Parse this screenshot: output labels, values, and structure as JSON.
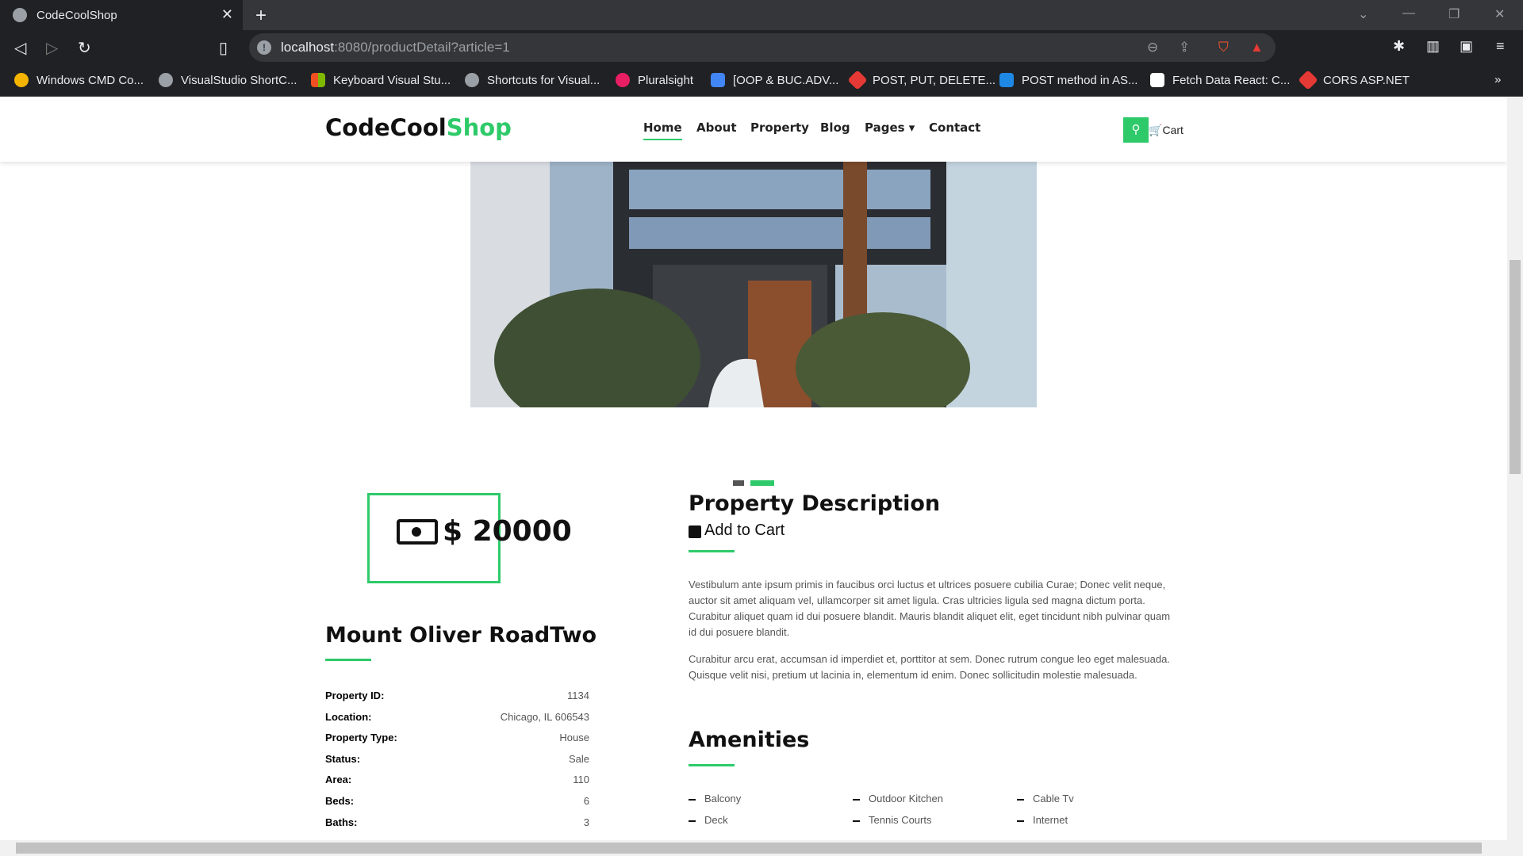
{
  "browser": {
    "tab_title": "CodeCoolShop",
    "url_host": "localhost",
    "url_rest": ":8080/productDetail?article=1",
    "bookmarks": [
      {
        "label": "Windows CMD Co...",
        "color": "#f4b400"
      },
      {
        "label": "VisualStudio ShortC...",
        "color": "#9aa0a6"
      },
      {
        "label": "Keyboard Visual Stu...",
        "color": "#f25022"
      },
      {
        "label": "Shortcuts for Visual...",
        "color": "#9aa0a6"
      },
      {
        "label": "Pluralsight",
        "color": "#e91e63"
      },
      {
        "label": "[OOP & BUC.ADV...",
        "color": "#4285f4"
      },
      {
        "label": "POST, PUT, DELETE...",
        "color": "#e53935"
      },
      {
        "label": "POST method in AS...",
        "color": "#1e88e5"
      },
      {
        "label": "Fetch Data React: C...",
        "color": "#ffffff"
      },
      {
        "label": "CORS ASP.NET",
        "color": "#e53935"
      }
    ],
    "more": "»"
  },
  "header": {
    "logo_main": "CodeCool",
    "logo_accent": "Shop",
    "nav": [
      "Home",
      "About",
      "Property",
      "Blog",
      "Pages",
      "Contact"
    ],
    "cart_label": "Cart"
  },
  "product": {
    "price": "$ 20000",
    "name": "Mount Oliver RoadTwo",
    "add_to_cart": "Add to Cart",
    "description_title": "Property Description",
    "description_p1": "Vestibulum ante ipsum primis in faucibus orci luctus et ultrices posuere cubilia Curae; Donec velit neque, auctor sit amet aliquam vel, ullamcorper sit amet ligula. Cras ultricies ligula sed magna dictum porta. Curabitur aliquet quam id dui posuere blandit. Mauris blandit aliquet elit, eget tincidunt nibh pulvinar quam id dui posuere blandit.",
    "description_p2": "Curabitur arcu erat, accumsan id imperdiet et, porttitor at sem. Donec rutrum congue leo eget malesuada. Quisque velit nisi, pretium ut lacinia in, elementum id enim. Donec sollicitudin molestie malesuada.",
    "specs": [
      {
        "k": "Property ID:",
        "v": "1134"
      },
      {
        "k": "Location:",
        "v": "Chicago, IL 606543"
      },
      {
        "k": "Property Type:",
        "v": "House"
      },
      {
        "k": "Status:",
        "v": "Sale"
      },
      {
        "k": "Area:",
        "v": "110"
      },
      {
        "k": "Beds:",
        "v": "6"
      },
      {
        "k": "Baths:",
        "v": "3"
      }
    ],
    "amenities_title": "Amenities",
    "amenities": [
      "Balcony",
      "Outdoor Kitchen",
      "Cable Tv",
      "Deck",
      "Tennis Courts",
      "Internet"
    ]
  },
  "accent": "#2eca6a"
}
